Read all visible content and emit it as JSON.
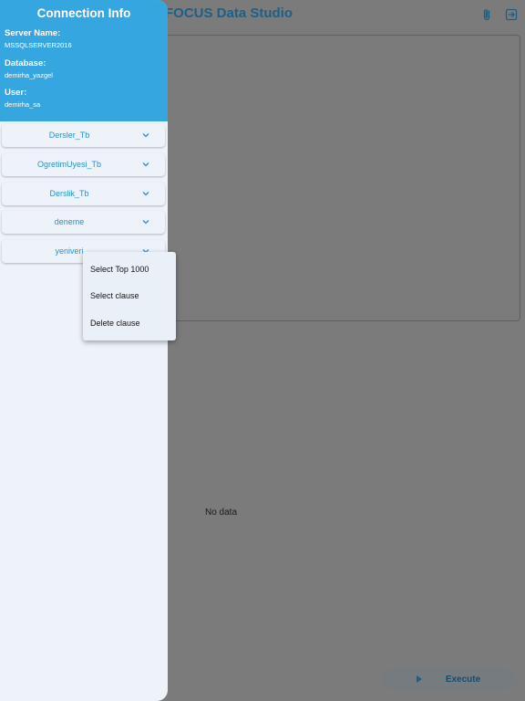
{
  "app": {
    "title": "FOCUS Data Studio",
    "no_data": "No data",
    "execute_label": "Execute",
    "icons": {
      "attach": "attach-icon",
      "exit": "exit-icon",
      "execute": "play-icon"
    }
  },
  "drawer": {
    "title": "Connection Info",
    "server_label": "Server Name:",
    "server_value": "MSSQLSERVER2016",
    "database_label": "Database:",
    "database_value": "demirha_yazgel",
    "user_label": "User:",
    "user_value": "demirha_sa",
    "tables": [
      {
        "name": "Dersler_Tb"
      },
      {
        "name": "OgretimUyesi_Tb"
      },
      {
        "name": "Derslik_Tb"
      },
      {
        "name": "deneme"
      },
      {
        "name": "yeniveri"
      }
    ]
  },
  "popup_menu": {
    "items": [
      "Select Top 1000",
      "Select clause",
      "Delete clause"
    ]
  },
  "colors": {
    "accent": "#36a6e0",
    "drawer_bg": "#eef2f9",
    "scrim_bg": "#7b7b7b",
    "table_label": "#2a93c9"
  }
}
